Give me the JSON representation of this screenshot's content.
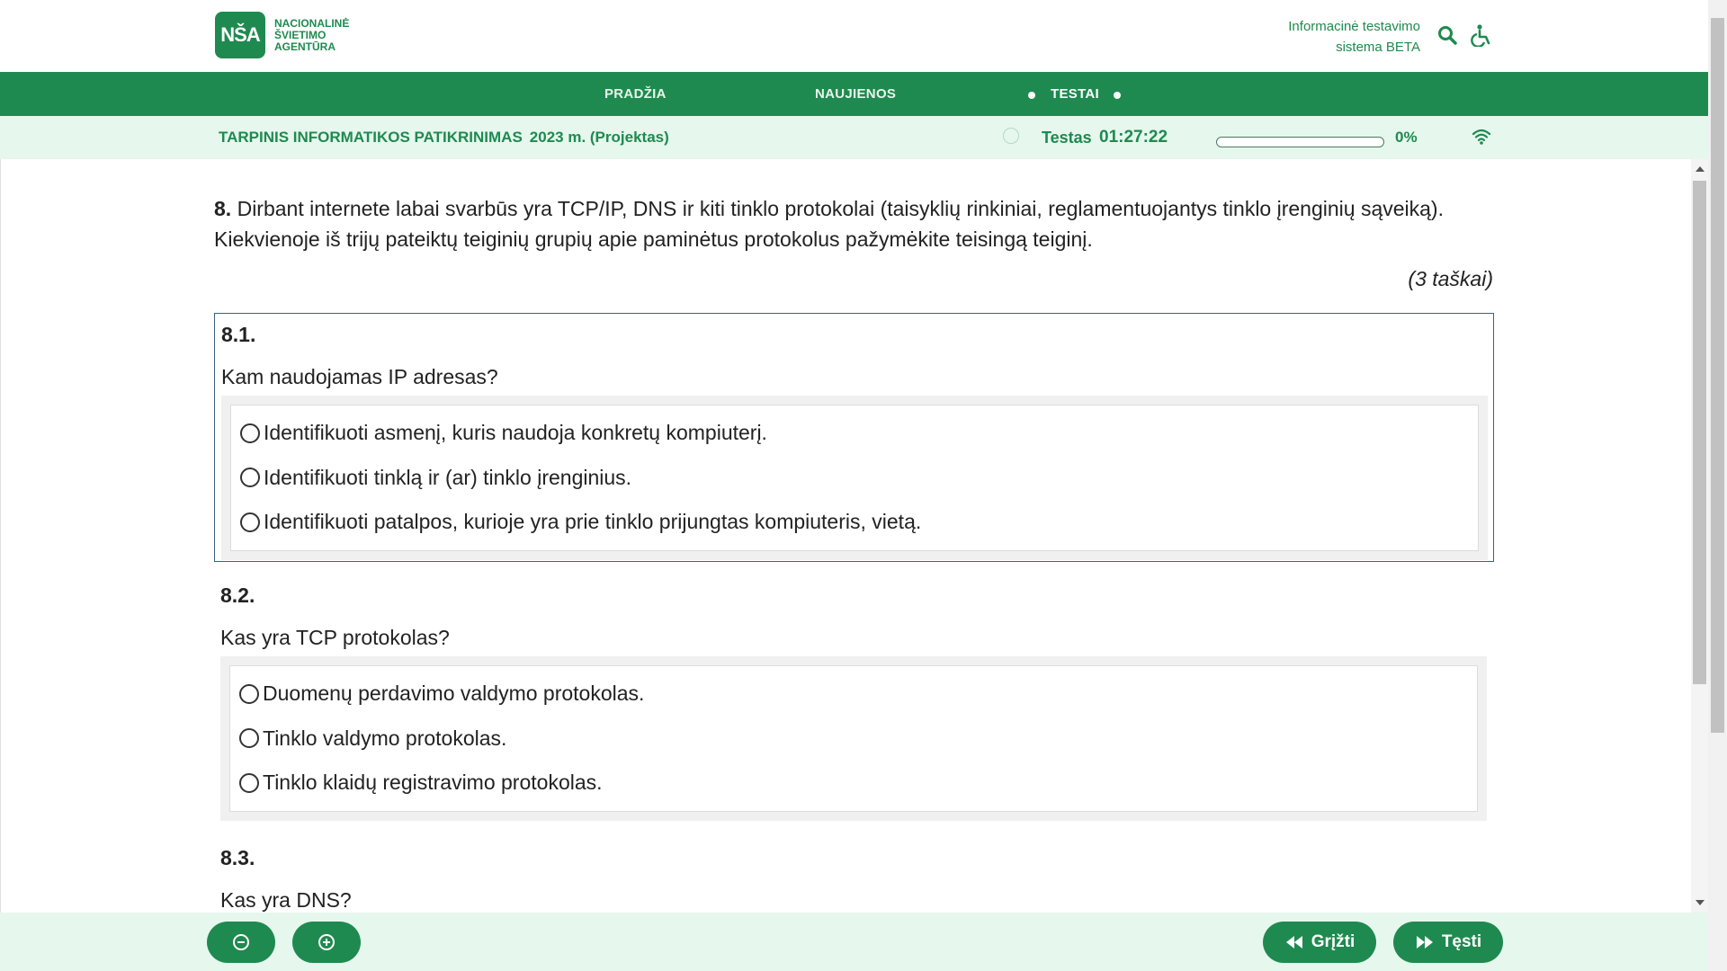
{
  "header": {
    "logo_mark": "NŠA",
    "logo_lines": [
      "NACIONALINĖ",
      "ŠVIETIMO",
      "AGENTŪRA"
    ],
    "system_title_line1": "Informacinė testavimo",
    "system_title_line2": "sistema BETA",
    "icons": [
      "search-icon",
      "accessibility-icon"
    ]
  },
  "nav": {
    "items": [
      {
        "label": "PRADŽIA"
      },
      {
        "label": "NAUJIENOS"
      },
      {
        "label": "TESTAI"
      }
    ],
    "active": "TESTAI"
  },
  "status": {
    "exam_title": "TARPINIS INFORMATIKOS PATIKRINIMAS",
    "exam_year": "2023 m. (Projektas)",
    "test_label": "Testas",
    "timer": "01:27:22",
    "progress_value": 0,
    "progress_text": "0%",
    "icons": [
      "clock-icon",
      "wifi-icon"
    ]
  },
  "question": {
    "number": "8.",
    "text": "Dirbant internete labai svarbūs yra TCP/IP, DNS ir kiti tinklo protokolai (taisyklių rinkiniai, reglamentuojantys tinklo įrenginių sąveiką). Kiekvienoje iš trijų pateiktų teiginių grupių apie paminėtus protokolus pažymėkite teisingą teiginį.",
    "points": "(3 taškai)",
    "subquestions": [
      {
        "number": "8.1.",
        "text": "Kam naudojamas IP adresas?",
        "options": [
          "Identifikuoti asmenį, kuris naudoja konkretų kompiuterį.",
          "Identifikuoti tinklą ir (ar) tinklo įrenginius.",
          "Identifikuoti patalpos, kurioje yra prie tinklo prijungtas kompiuteris, vietą."
        ]
      },
      {
        "number": "8.2.",
        "text": "Kas yra TCP protokolas?",
        "options": [
          "Duomenų perdavimo valdymo protokolas.",
          "Tinklo valdymo protokolas.",
          "Tinklo klaidų registravimo protokolas."
        ]
      },
      {
        "number": "8.3.",
        "text": "Kas yra DNS?"
      }
    ]
  },
  "footer": {
    "zoom_out_icon": "zoom-out-icon",
    "zoom_in_icon": "zoom-in-icon",
    "back_label": "Grįžti",
    "next_label": "Tęsti"
  },
  "colors": {
    "brand_green": "#1f8a4f",
    "status_bg": "#e6f7ee",
    "active_border": "#3b5f8a"
  }
}
